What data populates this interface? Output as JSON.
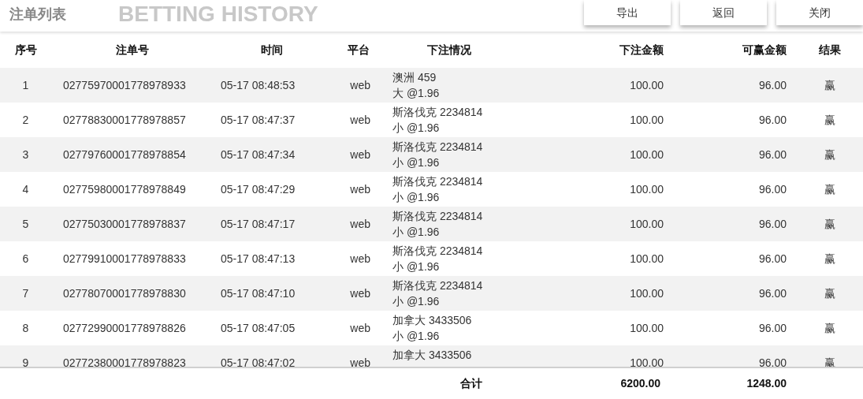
{
  "header": {
    "title": "注单列表",
    "subtitle": "BETTING HISTORY",
    "buttons": [
      "导出",
      "返回",
      "关闭"
    ]
  },
  "table": {
    "columns": [
      "序号",
      "注单号",
      "时间",
      "平台",
      "下注情况",
      "下注金额",
      "可赢金额",
      "结果"
    ],
    "rows": [
      {
        "seq": "1",
        "order_no": "02775970001778978933",
        "time": "05-17 08:48:53",
        "platform": "web",
        "bet": [
          "澳洲 459",
          "大 @1.96"
        ],
        "stake": "100.00",
        "win": "96.00",
        "result": "赢"
      },
      {
        "seq": "2",
        "order_no": "02778830001778978857",
        "time": "05-17 08:47:37",
        "platform": "web",
        "bet": [
          "斯洛伐克 2234814",
          "小 @1.96"
        ],
        "stake": "100.00",
        "win": "96.00",
        "result": "赢"
      },
      {
        "seq": "3",
        "order_no": "02779760001778978854",
        "time": "05-17 08:47:34",
        "platform": "web",
        "bet": [
          "斯洛伐克 2234814",
          "小 @1.96"
        ],
        "stake": "100.00",
        "win": "96.00",
        "result": "赢"
      },
      {
        "seq": "4",
        "order_no": "02775980001778978849",
        "time": "05-17 08:47:29",
        "platform": "web",
        "bet": [
          "斯洛伐克 2234814",
          "小 @1.96"
        ],
        "stake": "100.00",
        "win": "96.00",
        "result": "赢"
      },
      {
        "seq": "5",
        "order_no": "02775030001778978837",
        "time": "05-17 08:47:17",
        "platform": "web",
        "bet": [
          "斯洛伐克 2234814",
          "小 @1.96"
        ],
        "stake": "100.00",
        "win": "96.00",
        "result": "赢"
      },
      {
        "seq": "6",
        "order_no": "02779910001778978833",
        "time": "05-17 08:47:13",
        "platform": "web",
        "bet": [
          "斯洛伐克 2234814",
          "小 @1.96"
        ],
        "stake": "100.00",
        "win": "96.00",
        "result": "赢"
      },
      {
        "seq": "7",
        "order_no": "02778070001778978830",
        "time": "05-17 08:47:10",
        "platform": "web",
        "bet": [
          "斯洛伐克 2234814",
          "小 @1.96"
        ],
        "stake": "100.00",
        "win": "96.00",
        "result": "赢"
      },
      {
        "seq": "8",
        "order_no": "02772990001778978826",
        "time": "05-17 08:47:05",
        "platform": "web",
        "bet": [
          "加拿大 3433506",
          "小 @1.96"
        ],
        "stake": "100.00",
        "win": "96.00",
        "result": "赢"
      },
      {
        "seq": "9",
        "order_no": "02772380001778978823",
        "time": "05-17 08:47:02",
        "platform": "web",
        "bet": [
          "加拿大 3433506"
        ],
        "stake": "100.00",
        "win": "96.00",
        "result": "赢"
      }
    ],
    "footer": {
      "label": "合计",
      "stake_total": "6200.00",
      "win_total": "1248.00"
    }
  }
}
